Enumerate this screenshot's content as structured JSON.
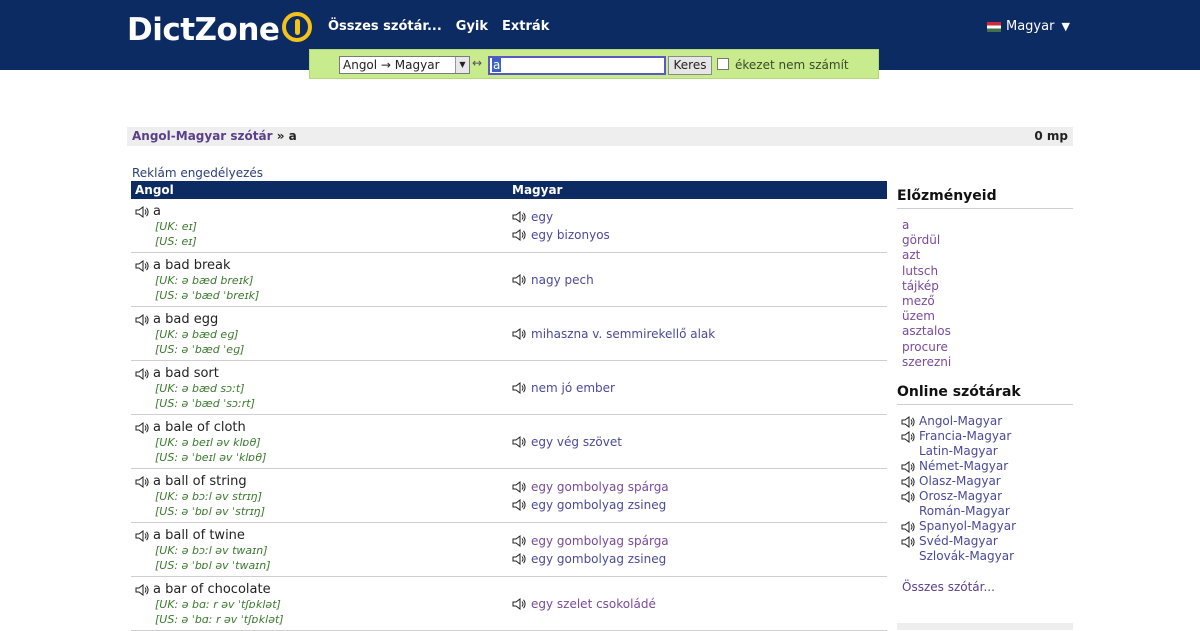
{
  "header": {
    "logo_text": "DictZone",
    "nav": [
      "Összes szótár...",
      "Gyik",
      "Extrák"
    ],
    "language": "Magyar",
    "lang_arrow": "▼"
  },
  "search": {
    "direction": "Angol → Magyar",
    "swap_symbol": "↔",
    "query": "a",
    "button": "Keres",
    "accent_label": "ékezet nem számít"
  },
  "breadcrumb": {
    "dictionary": "Angol-Magyar szótár",
    "separator": " » ",
    "term": "a",
    "time": "0 mp"
  },
  "ad_link": "Reklám engedélyezés",
  "table": {
    "col_en": "Angol",
    "col_hu": "Magyar",
    "rows": [
      {
        "word": "a",
        "uk": "[UK: eɪ]",
        "us": "[US: eɪ]",
        "tr": [
          "egy",
          "egy bizonyos"
        ]
      },
      {
        "word": "a bad break",
        "uk": "[UK: ə bæd breɪk]",
        "us": "[US: ə ˈbæd ˈbreɪk]",
        "tr": [
          "nagy pech"
        ]
      },
      {
        "word": "a bad egg",
        "uk": "[UK: ə bæd eɡ]",
        "us": "[US: ə ˈbæd ˈeɡ]",
        "tr": [
          "mihaszna v. semmirekellő alak"
        ]
      },
      {
        "word": "a bad sort",
        "uk": "[UK: ə bæd sɔːt]",
        "us": "[US: ə ˈbæd ˈsɔːrt]",
        "tr": [
          "nem jó ember"
        ]
      },
      {
        "word": "a bale of cloth",
        "uk": "[UK: ə beɪl əv klɒθ]",
        "us": "[US: ə ˈbeɪl əv ˈklɒθ]",
        "tr": [
          "egy vég szövet"
        ]
      },
      {
        "word": "a ball of string",
        "uk": "[UK: ə bɔːl əv strɪŋ]",
        "us": "[US: ə ˈbɒl əv ˈstrɪŋ]",
        "tr": [
          "egy gombolyag spárga",
          "egy gombolyag zsineg"
        ]
      },
      {
        "word": "a ball of twine",
        "uk": "[UK: ə bɔːl əv twaɪn]",
        "us": "[US: ə ˈbɒl əv ˈtwaɪn]",
        "tr": [
          "egy gombolyag spárga",
          "egy gombolyag zsineg"
        ]
      },
      {
        "word": "a bar of chocolate",
        "uk": "[UK: ə bɑː r əv ˈtʃɒklət]",
        "us": "[US: ə ˈbɑː r əv ˈtʃɒklət]",
        "tr": [
          "egy szelet csokoládé"
        ]
      }
    ]
  },
  "sidebar": {
    "history_title": "Előzményeid",
    "history": [
      "a",
      "gördül",
      "azt",
      "lutsch",
      "tájkép",
      "mező",
      "üzem",
      "asztalos",
      "procure",
      "szerezni"
    ],
    "dicts_title": "Online szótárak",
    "dicts": [
      {
        "name": "Angol-Magyar",
        "audio": true
      },
      {
        "name": "Francia-Magyar",
        "audio": true
      },
      {
        "name": "Latin-Magyar",
        "audio": false
      },
      {
        "name": "Német-Magyar",
        "audio": true
      },
      {
        "name": "Olasz-Magyar",
        "audio": true
      },
      {
        "name": "Orosz-Magyar",
        "audio": true
      },
      {
        "name": "Román-Magyar",
        "audio": false
      },
      {
        "name": "Spanyol-Magyar",
        "audio": true
      },
      {
        "name": "Svéd-Magyar",
        "audio": true
      },
      {
        "name": "Szlovák-Magyar",
        "audio": false
      }
    ],
    "all_link": "Összes szótár..."
  },
  "colors": {
    "header_bg": "#0d2b63",
    "search_bg": "#c8eb8e",
    "logo_accent": "#f3c21b",
    "link": "#5a3f8a",
    "pronunciation": "#3b7a2e"
  }
}
